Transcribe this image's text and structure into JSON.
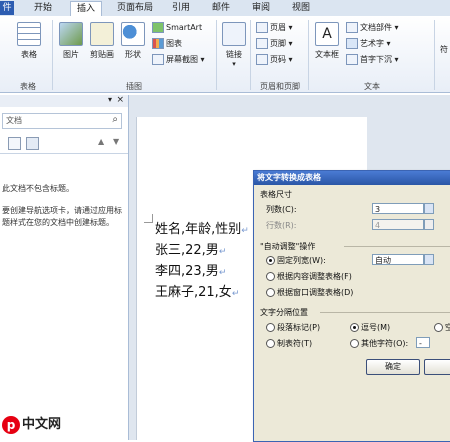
{
  "tabs": [
    {
      "label": "件"
    },
    {
      "label": "开始"
    },
    {
      "label": "插入"
    },
    {
      "label": "页面布局"
    },
    {
      "label": "引用"
    },
    {
      "label": "邮件"
    },
    {
      "label": "审阅"
    },
    {
      "label": "视图"
    }
  ],
  "ribbon": {
    "tables": {
      "btn": "表格",
      "group": "表格"
    },
    "illustrations": {
      "picture": "图片",
      "clipart": "剪贴画",
      "shapes": "形状",
      "smartart": "SmartArt",
      "chart": "图表",
      "screenshot": "屏幕截图",
      "group": "插图"
    },
    "links": {
      "btn": "链接"
    },
    "header_footer": {
      "header": "页眉",
      "footer": "页脚",
      "page_number": "页码",
      "group": "页眉和页脚"
    },
    "text": {
      "textbox": "文本框",
      "quickparts": "文档部件",
      "wordart": "艺术字",
      "dropcap": "首字下沉",
      "group": "文本"
    },
    "symbols": {
      "btn": "符"
    }
  },
  "nav_pane": {
    "search_placeholder": "文档",
    "message_1": "此文档不包含标题。",
    "message_2": "要创建导航选项卡，请通过应用标题样式在您的文档中创建标题。"
  },
  "document": {
    "lines": [
      "姓名,年龄,性别",
      "张三,22,男",
      "李四,23,男",
      "王麻子,21,女"
    ]
  },
  "dialog": {
    "title": "将文字转换成表格",
    "table_size": "表格尺寸",
    "columns_label": "列数(C):",
    "columns_value": "3",
    "rows_label": "行数(R):",
    "rows_value": "4",
    "autofit_label": "\"自动调整\"操作",
    "fixed_width_label": "固定列宽(W):",
    "fixed_width_value": "自动",
    "fit_content_label": "根据内容调整表格(F)",
    "fit_window_label": "根据窗口调整表格(D)",
    "separator_label": "文字分隔位置",
    "paragraph_label": "段落标记(P)",
    "comma_label": "逗号(M)",
    "space_label": "空",
    "tab_label": "制表符(T)",
    "other_label": "其他字符(O):",
    "other_value": "-",
    "ok_label": "确定"
  },
  "watermark": {
    "logo": "p",
    "text": "中文网"
  }
}
